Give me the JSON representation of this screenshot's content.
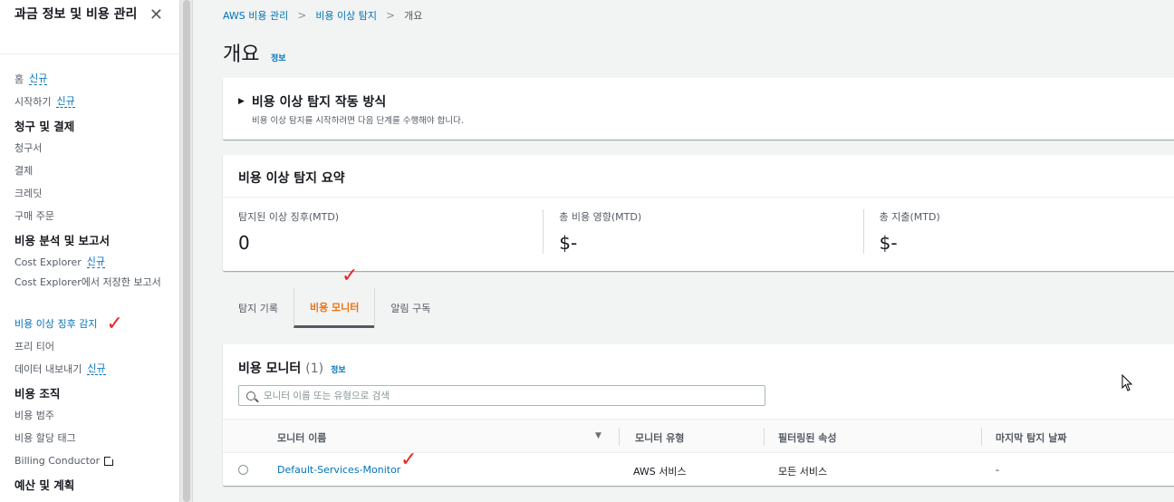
{
  "sidebar": {
    "title": "과금 정보 및 비용 관리",
    "close": "✕",
    "badge_new": "신규",
    "items": [
      {
        "label": "홈",
        "badge": "신규"
      },
      {
        "label": "시작하기",
        "badge": "신규"
      }
    ],
    "sections": [
      {
        "label": "청구 및 결제",
        "items": [
          "청구서",
          "결제",
          "크레딧",
          "구매 주문"
        ]
      },
      {
        "label": "비용 분석 및 보고서",
        "items": [
          "Cost Explorer",
          "Cost Explorer에서 저장한 보고서",
          "비용 이상 징후 감지",
          "프리 티어",
          "데이터 내보내기"
        ]
      },
      {
        "label": "비용 조직",
        "items": [
          "비용 범주",
          "비용 할당 태그",
          "Billing Conductor"
        ]
      },
      {
        "label": "예산 및 계획"
      }
    ]
  },
  "breadcrumb": {
    "items": [
      "AWS 비용 관리",
      "비용 이상 탐지",
      "개요"
    ],
    "separator": ">"
  },
  "page": {
    "title": "개요",
    "info": "정보"
  },
  "how_it_works": {
    "title": "비용 이상 탐지 작동 방식",
    "description": "비용 이상 탐지를 시작하려면 다음 단계를 수행해야 합니다."
  },
  "summary": {
    "title": "비용 이상 탐지 요약",
    "metrics": [
      {
        "label": "탐지된 이상 징후(MTD)",
        "value": "0"
      },
      {
        "label": "총 비용 영향(MTD)",
        "value": "$-"
      },
      {
        "label": "총 지출(MTD)",
        "value": "$-"
      }
    ]
  },
  "tabs": [
    "탐지 기록",
    "비용 모니터",
    "알림 구독"
  ],
  "monitors": {
    "title": "비용 모니터",
    "count": "(1)",
    "info": "정보",
    "search_placeholder": "모니터 이름 또는 유형으로 검색",
    "columns": [
      "모니터 이름",
      "모니터 유형",
      "필터링된 속성",
      "마지막 탐지 날짜"
    ],
    "rows": [
      {
        "name": "Default-Services-Monitor",
        "type": "AWS 서비스",
        "filtered": "모든 서비스",
        "last": "-"
      }
    ]
  },
  "colors": {
    "link": "#0073bb",
    "active_tab": "#ec7211",
    "annotation": "#e22222"
  }
}
